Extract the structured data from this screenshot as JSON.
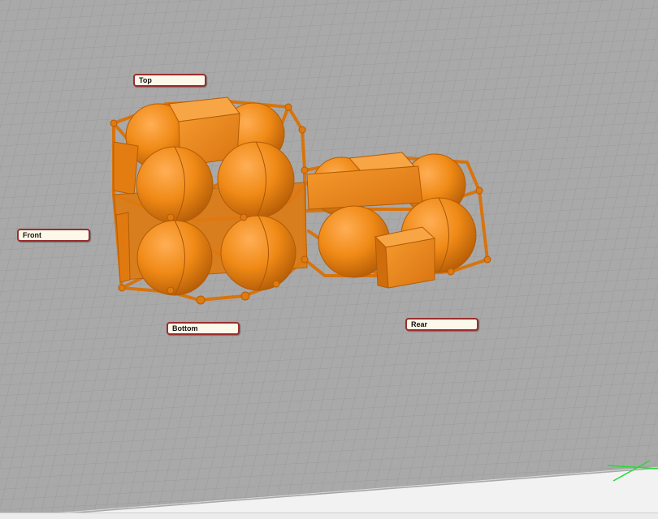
{
  "viewport": {
    "view_labels": [
      {
        "id": "top",
        "text": "Top"
      },
      {
        "id": "front",
        "text": "Front"
      },
      {
        "id": "bottom",
        "text": "Bottom"
      },
      {
        "id": "rear",
        "text": "Rear"
      }
    ]
  },
  "colors": {
    "model_orange": "#f08a16",
    "model_orange_dark": "#c9690a",
    "model_orange_light": "#ffae55",
    "grid_background": "#a9a9a9",
    "grid_line": "#969696",
    "label_border": "#9a2d2d",
    "label_fill": "#fdf9ea",
    "axis_green": "#22dd33"
  },
  "icons": {
    "axis_gizmo": "xyz-axis-gizmo-icon"
  }
}
